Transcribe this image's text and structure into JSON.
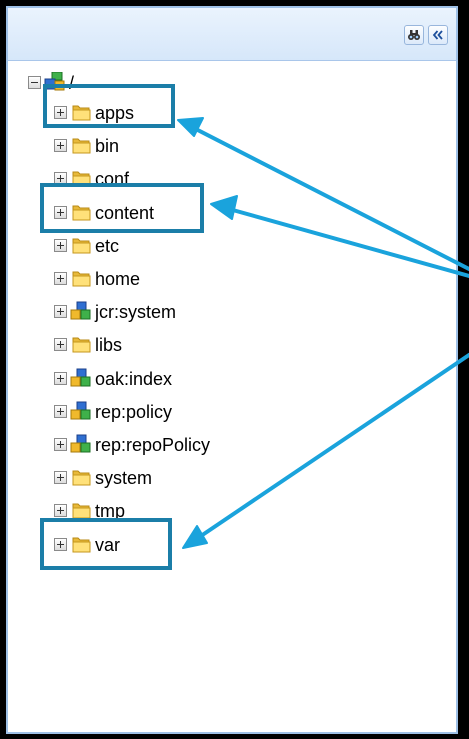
{
  "toolbar": {
    "buttons": [
      {
        "name": "find-button",
        "icon": "binoculars-icon"
      },
      {
        "name": "collapse-panel-button",
        "icon": "double-chevron-left-icon"
      }
    ]
  },
  "tree": {
    "root": {
      "label": "/",
      "icon": "repository-icon",
      "expanded": true
    },
    "children": [
      {
        "label": "apps",
        "icon": "folder-icon",
        "highlighted": true
      },
      {
        "label": "bin",
        "icon": "folder-icon"
      },
      {
        "label": "conf",
        "icon": "folder-icon"
      },
      {
        "label": "content",
        "icon": "folder-icon",
        "highlighted": true
      },
      {
        "label": "etc",
        "icon": "folder-icon"
      },
      {
        "label": "home",
        "icon": "folder-icon"
      },
      {
        "label": "jcr:system",
        "icon": "node-cubes-icon"
      },
      {
        "label": "libs",
        "icon": "folder-icon"
      },
      {
        "label": "oak:index",
        "icon": "node-cubes-icon"
      },
      {
        "label": "rep:policy",
        "icon": "node-cubes-icon"
      },
      {
        "label": "rep:repoPolicy",
        "icon": "node-cubes-icon"
      },
      {
        "label": "system",
        "icon": "folder-icon"
      },
      {
        "label": "tmp",
        "icon": "folder-icon"
      },
      {
        "label": "var",
        "icon": "folder-icon",
        "highlighted": true
      }
    ]
  },
  "colors": {
    "annotation_box": "#1b7ea8",
    "annotation_arrow": "#1aa3dc",
    "panel_border": "#9ec0e6",
    "toolbar_top": "#eaf3fd",
    "toolbar_bottom": "#d6e7fa"
  }
}
